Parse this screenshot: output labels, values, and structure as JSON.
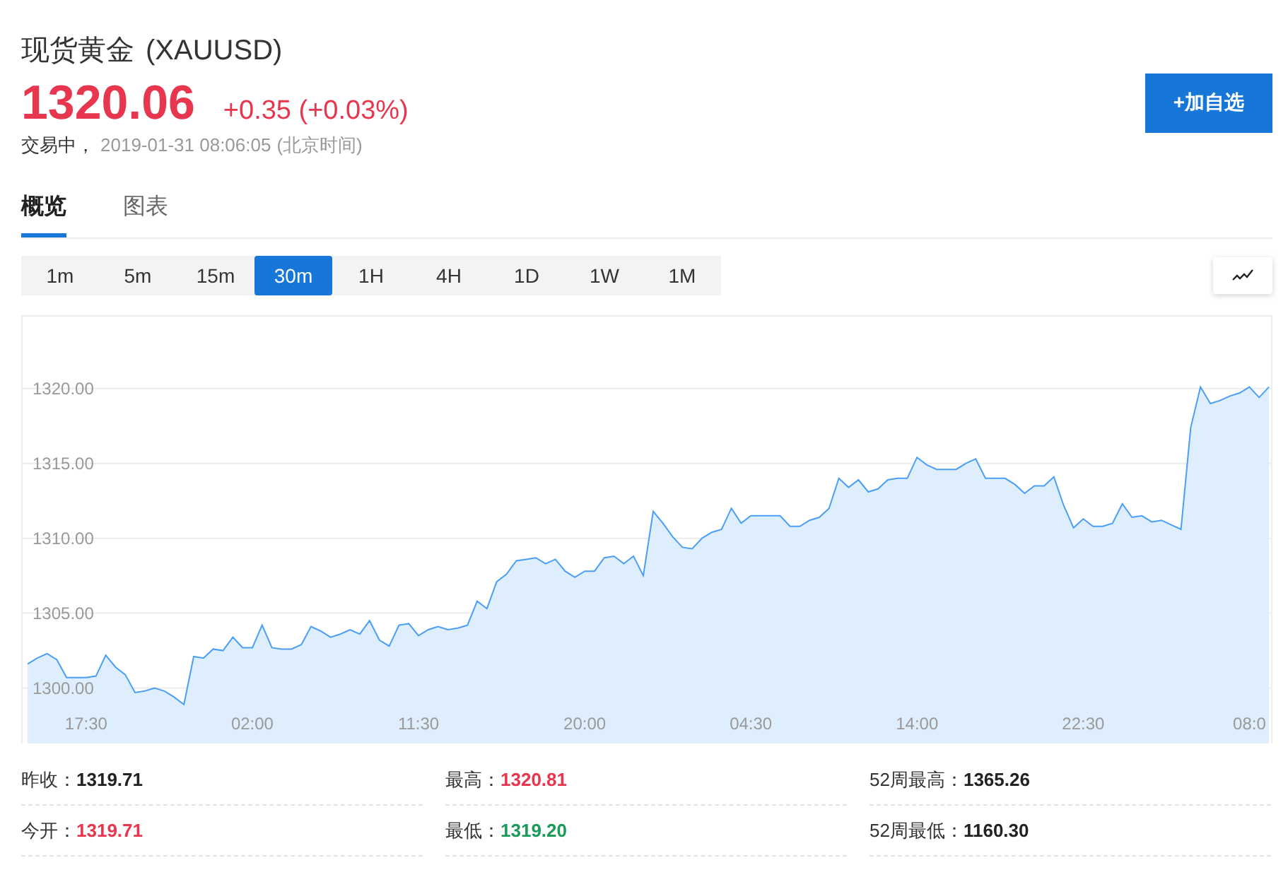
{
  "header": {
    "name": "现货黄金",
    "symbol": "(XAUUSD)",
    "price": "1320.06",
    "change": "+0.35 (+0.03%)",
    "status": "交易中，",
    "time": "2019-01-31 08:06:05",
    "timezone": "(北京时间)"
  },
  "watch_button": "+加自选",
  "tabs": [
    {
      "label": "概览",
      "selected": true
    },
    {
      "label": "图表",
      "selected": false
    }
  ],
  "intervals": [
    {
      "label": "1m",
      "selected": false
    },
    {
      "label": "5m",
      "selected": false
    },
    {
      "label": "15m",
      "selected": false
    },
    {
      "label": "30m",
      "selected": true
    },
    {
      "label": "1H",
      "selected": false
    },
    {
      "label": "4H",
      "selected": false
    },
    {
      "label": "1D",
      "selected": false
    },
    {
      "label": "1W",
      "selected": false
    },
    {
      "label": "1M",
      "selected": false
    }
  ],
  "chart": {
    "chart_data": {
      "type": "area",
      "ylim": [
        1296.3,
        1324.8
      ],
      "yticks": [
        {
          "value": 1300,
          "label": "1300.00"
        },
        {
          "value": 1305,
          "label": "1305.00"
        },
        {
          "value": 1310,
          "label": "1310.00"
        },
        {
          "value": 1315,
          "label": "1315.00"
        },
        {
          "value": 1320,
          "label": "1320.00"
        }
      ],
      "categories": [
        null,
        null,
        null,
        null,
        null,
        null,
        "17:30",
        null,
        null,
        null,
        null,
        null,
        null,
        null,
        null,
        null,
        null,
        null,
        null,
        null,
        null,
        null,
        null,
        "02:00",
        null,
        null,
        null,
        null,
        null,
        null,
        null,
        null,
        null,
        null,
        null,
        null,
        null,
        null,
        null,
        null,
        "11:30",
        null,
        null,
        null,
        null,
        null,
        null,
        null,
        null,
        null,
        null,
        null,
        null,
        null,
        null,
        null,
        null,
        "20:00",
        null,
        null,
        null,
        null,
        null,
        null,
        null,
        null,
        null,
        null,
        null,
        null,
        null,
        null,
        null,
        null,
        "04:30",
        null,
        null,
        null,
        null,
        null,
        null,
        null,
        null,
        null,
        null,
        null,
        null,
        null,
        null,
        null,
        null,
        "14:00",
        null,
        null,
        null,
        null,
        null,
        null,
        null,
        null,
        null,
        null,
        null,
        null,
        null,
        null,
        null,
        null,
        "22:30",
        null,
        null,
        null,
        null,
        null,
        null,
        null,
        null,
        null,
        null,
        null,
        null,
        null,
        null,
        null,
        null,
        "08:0",
        null,
        null
      ],
      "grid": true,
      "series": [
        {
          "color": "#4a9ff5",
          "values": [
            1301.6,
            1302.0,
            1302.3,
            1301.9,
            1300.7,
            1300.7,
            1300.7,
            1300.8,
            1302.2,
            1301.4,
            1300.9,
            1299.7,
            1299.8,
            1300.0,
            1299.8,
            1299.4,
            1298.9,
            1302.1,
            1302.0,
            1302.6,
            1302.5,
            1303.4,
            1302.7,
            1302.7,
            1304.2,
            1302.7,
            1302.6,
            1302.6,
            1302.9,
            1304.1,
            1303.8,
            1303.4,
            1303.6,
            1303.9,
            1303.6,
            1304.5,
            1303.2,
            1302.8,
            1304.2,
            1304.3,
            1303.5,
            1303.9,
            1304.1,
            1303.9,
            1304.0,
            1304.2,
            1305.8,
            1305.3,
            1307.1,
            1307.6,
            1308.5,
            1308.6,
            1308.7,
            1308.3,
            1308.6,
            1307.8,
            1307.4,
            1307.8,
            1307.8,
            1308.7,
            1308.8,
            1308.3,
            1308.8,
            1307.5,
            1311.8,
            1311.0,
            1310.1,
            1309.4,
            1309.3,
            1310.0,
            1310.4,
            1310.6,
            1312.0,
            1311.0,
            1311.5,
            1311.5,
            1311.5,
            1311.5,
            1310.8,
            1310.8,
            1311.2,
            1311.4,
            1312.0,
            1314.0,
            1313.4,
            1313.9,
            1313.1,
            1313.3,
            1313.9,
            1314.0,
            1314.0,
            1315.4,
            1314.9,
            1314.6,
            1314.6,
            1314.6,
            1315.0,
            1315.3,
            1314.0,
            1314.0,
            1314.0,
            1313.6,
            1313.0,
            1313.5,
            1313.5,
            1314.1,
            1312.2,
            1310.7,
            1311.3,
            1310.8,
            1310.8,
            1311.0,
            1312.3,
            1311.4,
            1311.5,
            1311.1,
            1311.2,
            1310.9,
            1310.6,
            1317.4,
            1320.1,
            1319.0,
            1319.2,
            1319.5,
            1319.7,
            1320.1,
            1319.4,
            1320.1
          ]
        }
      ]
    }
  },
  "stats": [
    {
      "label": "昨收：",
      "value": "1319.71",
      "color": "#222222"
    },
    {
      "label": "最高：",
      "value": "1320.81",
      "color": "#e8364f"
    },
    {
      "label": "52周最高：",
      "value": "1365.26",
      "color": "#222222"
    },
    {
      "label": "今开：",
      "value": "1319.71",
      "color": "#e8364f"
    },
    {
      "label": "最低：",
      "value": "1319.20",
      "color": "#1a9b5a"
    },
    {
      "label": "52周最低：",
      "value": "1160.30",
      "color": "#222222"
    }
  ]
}
